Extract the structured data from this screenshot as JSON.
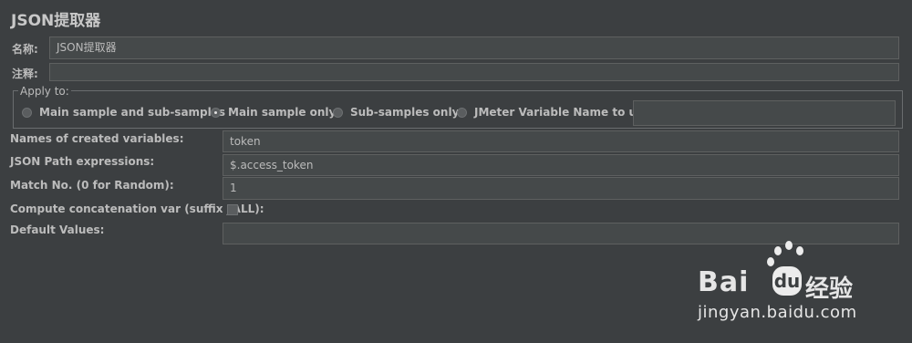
{
  "panel": {
    "title": "JSON提取器",
    "name_label": "名称:",
    "name_value": "JSON提取器",
    "comment_label": "注释:",
    "comment_value": ""
  },
  "apply_to": {
    "legend": "Apply to:",
    "options": [
      {
        "label": "Main sample and sub-samples",
        "selected": false
      },
      {
        "label": "Main sample only",
        "selected": true
      },
      {
        "label": "Sub-samples only",
        "selected": false
      },
      {
        "label": "JMeter Variable Name to use",
        "selected": false
      }
    ],
    "variable_name_value": ""
  },
  "fields": {
    "names_label": "Names of created variables:",
    "names_value": "token",
    "json_path_label": "JSON Path expressions:",
    "json_path_value": "$.access_token",
    "match_no_label": "Match No. (0 for Random):",
    "match_no_value": "1",
    "concat_label": "Compute concatenation var (suffix _ALL):",
    "concat_checked": false,
    "default_label": "Default Values:",
    "default_value": ""
  },
  "watermark": {
    "brand_bai": "Bai",
    "brand_du": "du",
    "brand_cn": "经验",
    "url": "jingyan.baidu.com"
  }
}
